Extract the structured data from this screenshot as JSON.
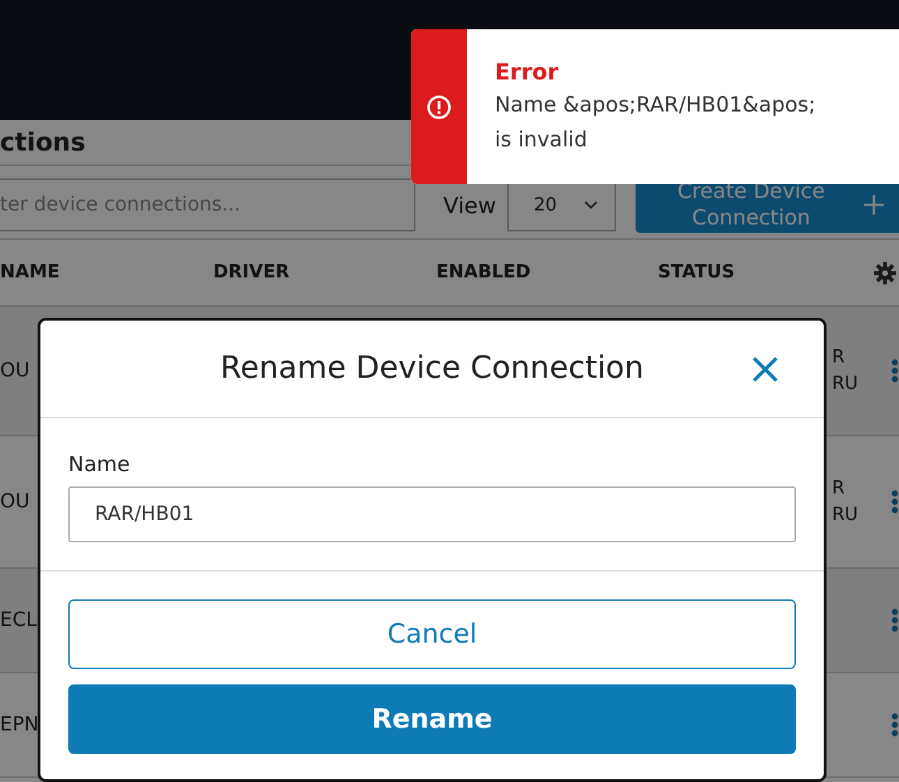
{
  "page_title": "ctions",
  "filter": {
    "placeholder": "ter device connections..."
  },
  "view": {
    "label": "View",
    "value": "20"
  },
  "create_button": "Create Device Connection",
  "table": {
    "columns": [
      "NAME",
      "DRIVER",
      "ENABLED",
      "STATUS"
    ],
    "rows": [
      {
        "name": "OU",
        "column_5": [
          "R",
          "RU"
        ]
      },
      {
        "name": "OU",
        "column_5": [
          "R",
          "RU"
        ]
      },
      {
        "name": "ECL"
      },
      {
        "name": "EPN"
      }
    ]
  },
  "dialog": {
    "title": "Rename Device Connection",
    "field_label": "Name",
    "value": "RAR/HB01",
    "buttons": [
      {
        "label": "Cancel",
        "kind": "secondary"
      },
      {
        "label": "Rename",
        "kind": "primary"
      }
    ]
  },
  "toast": {
    "kind": "error",
    "title": "Error",
    "message": "Name &apos;RAR/HB01&apos; is invalid"
  }
}
